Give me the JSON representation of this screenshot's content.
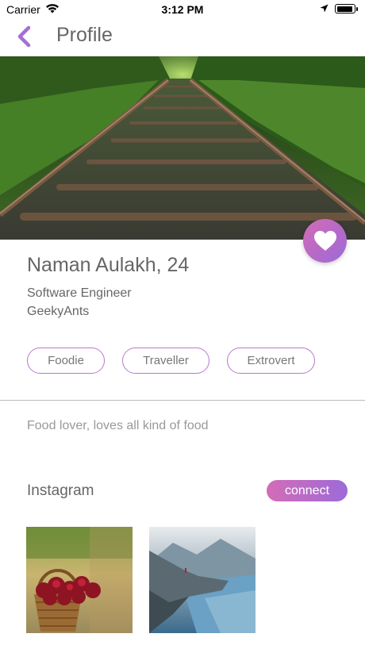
{
  "status_bar": {
    "carrier": "Carrier",
    "time": "3:12 PM",
    "icons": [
      "wifi-icon",
      "location-arrow-icon",
      "battery-icon"
    ]
  },
  "nav": {
    "back_icon": "chevron-left-icon",
    "title": "Profile"
  },
  "profile": {
    "name_age": "Naman Aulakh, 24",
    "job": "Software Engineer",
    "company": "GeekyAnts",
    "tags": [
      "Foodie",
      "Traveller",
      "Extrovert"
    ],
    "bio": "Food lover, loves all kind of food"
  },
  "instagram": {
    "title": "Instagram",
    "connect_label": "connect"
  },
  "colors": {
    "accent_start": "#d46bb5",
    "accent_end": "#9b6ad8",
    "back_arrow": "#a46fd6"
  }
}
